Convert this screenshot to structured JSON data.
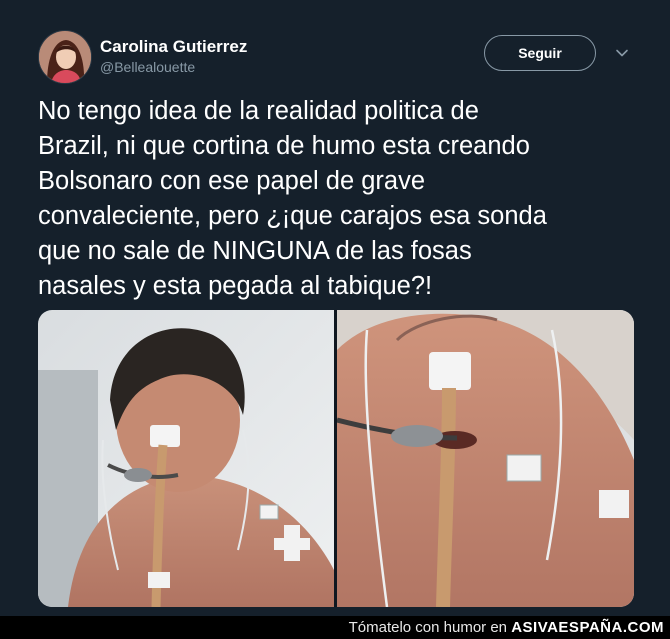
{
  "tweet": {
    "author_name": "Carolina Gutierrez",
    "author_handle": "@Bellealouette",
    "follow_label": "Seguir",
    "text_lines": [
      "No tengo idea de la realidad politica de",
      "Brazil, ni que cortina de humo esta creando",
      "Bolsonaro con ese papel de grave",
      "convaleciente, pero ¿¡que carajos esa sonda",
      "que no sale de NINGUNA de las fosas",
      "nasales y esta pegada al tabique?!"
    ],
    "media": {
      "icons": [
        "photo-left",
        "photo-right"
      ]
    }
  },
  "footer": {
    "tagline": "Tómatelo con humor en",
    "brand": "ASIVAESPAÑA.COM"
  },
  "colors": {
    "background": "#15202b",
    "text": "#ffffff",
    "muted": "#8899a6",
    "footer_bg": "#000000"
  }
}
